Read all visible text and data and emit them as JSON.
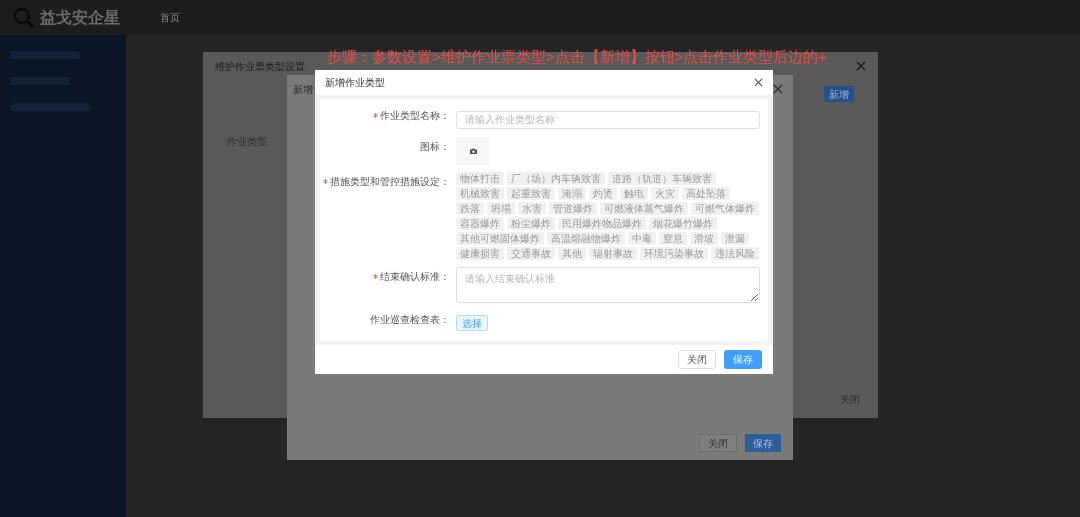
{
  "annotation": "步骤：参数设置>维护作业票类型>点击【新增】按钮>点击作业类型后边的+",
  "header": {
    "logo": "益戈安企星",
    "nav": [
      {
        "label": "首页"
      }
    ]
  },
  "background_dialog": {
    "title": "维护作业票类型设置",
    "add_button": "新增",
    "field_label": "作业类型",
    "close_button": "关闭"
  },
  "middle_dialog": {
    "title": "新增",
    "close_button": "关闭",
    "save_button": "保存"
  },
  "dialog": {
    "title": "新增作业类型",
    "fields": [
      {
        "kind": "input",
        "label": "作业类型名称：",
        "required": true,
        "placeholder": "请输入作业类型名称"
      },
      {
        "kind": "upload",
        "label": "图标：",
        "required": false
      },
      {
        "kind": "tags",
        "label": "措施类型和管控措施设定：",
        "required": true,
        "tags": [
          "物体打击",
          "厂（场）内车辆致害",
          "道路（轨道）车辆致害",
          "机械致害",
          "起重致害",
          "淹溺",
          "灼烫",
          "触电",
          "火灾",
          "高处坠落",
          "跌落",
          "坍塌",
          "水害",
          "管道爆炸",
          "可燃液体蒸气爆炸",
          "可燃气体爆炸",
          "容器爆炸",
          "粉尘爆炸",
          "民用爆炸物品爆炸",
          "烟花爆竹爆炸",
          "其他可燃固体爆炸",
          "高温熔融物爆炸",
          "中毒",
          "窒息",
          "滑坡",
          "泄漏",
          "健康损害",
          "交通事故",
          "其他",
          "辐射事故",
          "环境污染事故",
          "违法风险"
        ]
      },
      {
        "kind": "textarea",
        "label": "结束确认标准：",
        "required": true,
        "placeholder": "请输入结束确认标准"
      },
      {
        "kind": "button",
        "label": "作业巡查检查表：",
        "required": false,
        "button": "选择"
      }
    ],
    "buttons": [
      {
        "label": "关闭",
        "kind": "default"
      },
      {
        "label": "保存",
        "kind": "primary"
      }
    ]
  }
}
